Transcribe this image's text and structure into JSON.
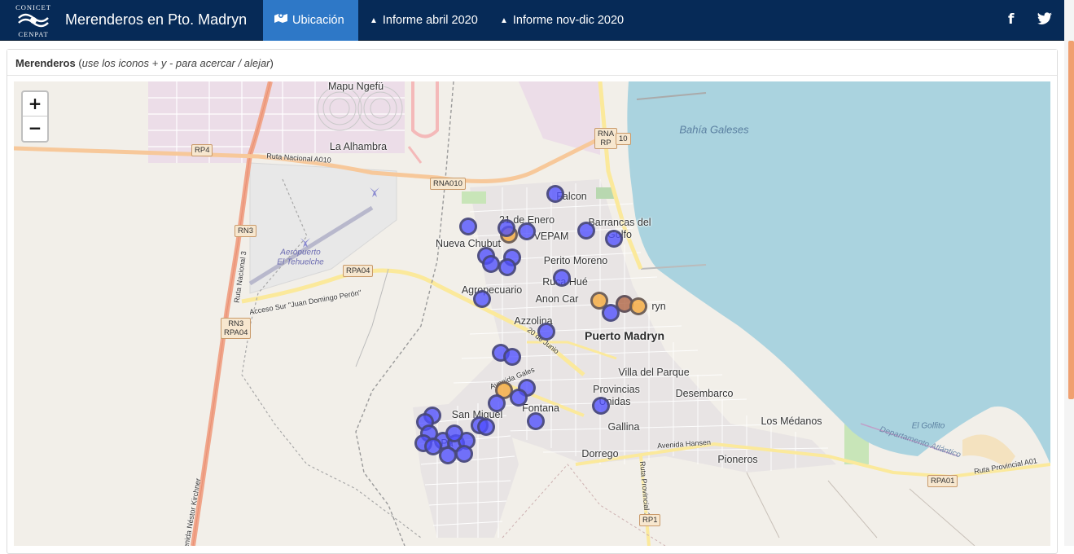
{
  "navbar": {
    "logo": {
      "line1": "CONICET",
      "line2": "CENPAT"
    },
    "title": "Merenderos en Pto. Madryn",
    "items": [
      {
        "label": "Ubicación",
        "icon": "map-marked-icon",
        "active": true
      },
      {
        "label": "Informe abril 2020",
        "icon": "caret-up-icon",
        "active": false
      },
      {
        "label": "Informe nov-dic 2020",
        "icon": "caret-up-icon",
        "active": false
      }
    ],
    "social": {
      "facebook": "f",
      "twitter": "🐦"
    }
  },
  "panel": {
    "title": "Merenderos",
    "hint_open": " (",
    "hint": "use los iconos + y - para acercar / alejar",
    "hint_close": ")"
  },
  "map": {
    "zoom_in": "+",
    "zoom_out": "−",
    "labels": {
      "mapu_ngefu": "Mapu Ngefü",
      "la_alhambra": "La Alhambra",
      "bahia_galeses": "Bahía Galeses",
      "falcon": "Falcon",
      "veintiuno_enero": "21 de Enero",
      "barrancas": "Barrancas del",
      "golfo": "Golfo",
      "nueva_chubut": "Nueva Chubut",
      "vepam": "VEPAM",
      "perito_moreno": "Perito Moreno",
      "ruca_hue": "Ruca Hué",
      "agropecuario": "Agropecuario",
      "anon_car": "Anon Car",
      "madryn_partial": "ryn",
      "azzolina": "Azzolina",
      "puerto_madryn": "Puerto Madryn",
      "villa_parque": "Villa del Parque",
      "provincias": "Provincias",
      "unidas": "Unidas",
      "desembarco": "Desembarco",
      "fontana": "Fontana",
      "san_miguel": "San Miguel",
      "gallina": "Gallina",
      "los_medanos": "Los Médanos",
      "dorrego": "Dorrego",
      "pioneros": "Pioneros",
      "el_golfito": "El Golfito",
      "dep_atlantico": "Departamento Atlántico",
      "aeropuerto": "Aeropuerto",
      "el_tehuelche": "El Tehuelche",
      "ruta_a010": "Ruta Nacional A010",
      "ruta_n3": "Ruta Nacional 3",
      "acceso_sur": "Acceso Sur \"Juan Domingo Perón\"",
      "av_gales": "Avenida Gales",
      "veinte_junio": "20 de Junio",
      "av_hansen": "Avenida Hansen",
      "ruta_prov_1": "Ruta Provincial 1",
      "ruta_prov_a01": "Ruta Provincial A01",
      "av_kirchner": "Avenida Néstor Kirchner",
      "el_partial": "Pa"
    },
    "shields": {
      "rp4": "RP4",
      "rn3": "RN3",
      "rn3_rpa04_a": "RN3",
      "rn3_rpa04_b": "RPA04",
      "rpa04": "RPA04",
      "rna010": "RNA010",
      "rna10_a": "RNA",
      "rna10_b": "10",
      "rna10_c": "RP",
      "rp1": "RP1",
      "rpa01": "RPA01"
    },
    "markers": [
      {
        "color": "blue"
      },
      {
        "color": "blue"
      },
      {
        "color": "orange"
      },
      {
        "color": "blue"
      },
      {
        "color": "blue"
      },
      {
        "color": "blue"
      },
      {
        "color": "blue"
      },
      {
        "color": "blue"
      },
      {
        "color": "blue"
      },
      {
        "color": "blue"
      },
      {
        "color": "blue"
      },
      {
        "color": "blue"
      },
      {
        "color": "orange"
      },
      {
        "color": "brown"
      },
      {
        "color": "orange"
      },
      {
        "color": "blue"
      },
      {
        "color": "blue"
      },
      {
        "color": "blue"
      },
      {
        "color": "blue"
      },
      {
        "color": "orange"
      },
      {
        "color": "blue"
      },
      {
        "color": "blue"
      },
      {
        "color": "blue"
      },
      {
        "color": "blue"
      },
      {
        "color": "blue"
      },
      {
        "color": "blue"
      },
      {
        "color": "blue"
      },
      {
        "color": "blue"
      },
      {
        "color": "blue"
      },
      {
        "color": "blue"
      },
      {
        "color": "blue"
      },
      {
        "color": "blue"
      },
      {
        "color": "blue"
      },
      {
        "color": "blue"
      },
      {
        "color": "blue"
      },
      {
        "color": "blue"
      },
      {
        "color": "blue"
      },
      {
        "color": "blue"
      },
      {
        "color": "blue"
      }
    ]
  },
  "colors": {
    "navbar": "#062a57",
    "active_tab": "#2e78c7",
    "water": "#aad3df",
    "land": "#f2efe9",
    "marker_blue": "#5050ff",
    "marker_orange": "#f5aa3c"
  }
}
